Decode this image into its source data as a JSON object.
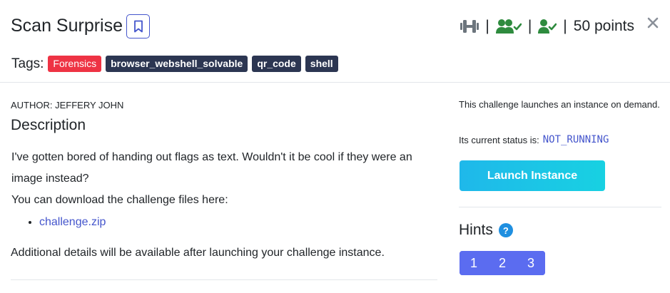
{
  "challenge": {
    "title": "Scan Surprise",
    "points": "50 points",
    "stat_separator": "|"
  },
  "tags": {
    "label": "Tags:",
    "items": [
      "Forensics",
      "browser_webshell_solvable",
      "qr_code",
      "shell"
    ]
  },
  "author": "AUTHOR: JEFFERY JOHN",
  "description": {
    "heading": "Description",
    "paragraph": "I've gotten bored of handing out flags as text. Wouldn't it be cool if they were an image instead?",
    "download_text": "You can download the challenge files here:",
    "download_link": "challenge.zip",
    "additional": "Additional details will be available after launching your challenge instance."
  },
  "instance": {
    "launch_text": "This challenge launches an instance on demand.",
    "status_label": "Its current status is:",
    "status_value": "NOT_RUNNING",
    "launch_button": "Launch Instance"
  },
  "hints": {
    "heading": "Hints",
    "help_glyph": "?",
    "buttons": [
      "1",
      "2",
      "3"
    ]
  },
  "colors": {
    "accent": "#4455cc",
    "tag_forensics": "#ee3344",
    "tag_dark": "#2c3652",
    "success_green": "#2e8b3e",
    "launch_gradient_start": "#1fb8ea",
    "launch_gradient_end": "#18d1e2",
    "hint_button": "#5b6cf0"
  },
  "icons": {
    "bookmark": "bookmark-icon",
    "difficulty": "dumbbell-icon",
    "solvers": "users-check-icon",
    "solved": "user-check-icon",
    "close": "close-icon",
    "help": "help-icon"
  }
}
